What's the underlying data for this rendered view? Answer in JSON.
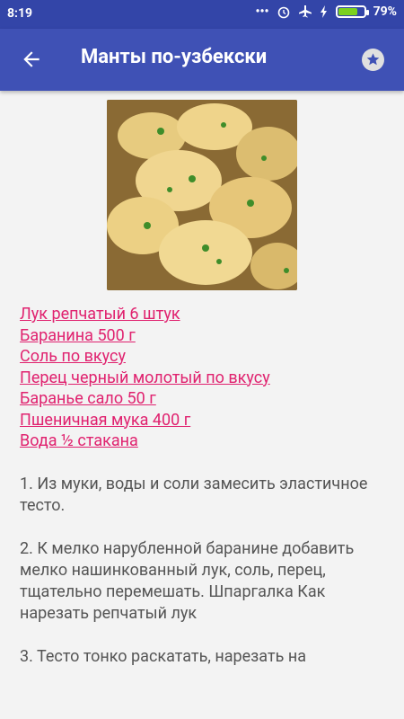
{
  "status_bar": {
    "time": "8:19",
    "battery_percent": "79%",
    "battery_level": 0.79
  },
  "app_bar": {
    "title": "Манты по-узбекски",
    "back_icon": "arrow-back-icon",
    "favorite_icon": "star-icon"
  },
  "recipe_image": {
    "alt": "Манты"
  },
  "ingredients": [
    "Лук репчатый 6 штук",
    "Баранина 500 г",
    "Соль по вкусу",
    "Перец черный молотый по вкусу",
    "Баранье сало 50 г",
    "Пшеничная мука 400 г",
    "Вода ½ стакана"
  ],
  "steps": [
    "1. Из муки, воды и соли замесить эластичное тесто.",
    "2. К мелко нарубленной баранине добавить мелко нашинкованный лук, соль, перец, тщательно перемешать. Шпаргалка Как нарезать репчатый лук",
    "3. Тесто тонко раскатать, нарезать на"
  ],
  "colors": {
    "status_bar": "#3345a8",
    "app_bar": "#3f51b5",
    "link": "#e0226f",
    "text": "#555555",
    "background": "#f3f3f3"
  }
}
